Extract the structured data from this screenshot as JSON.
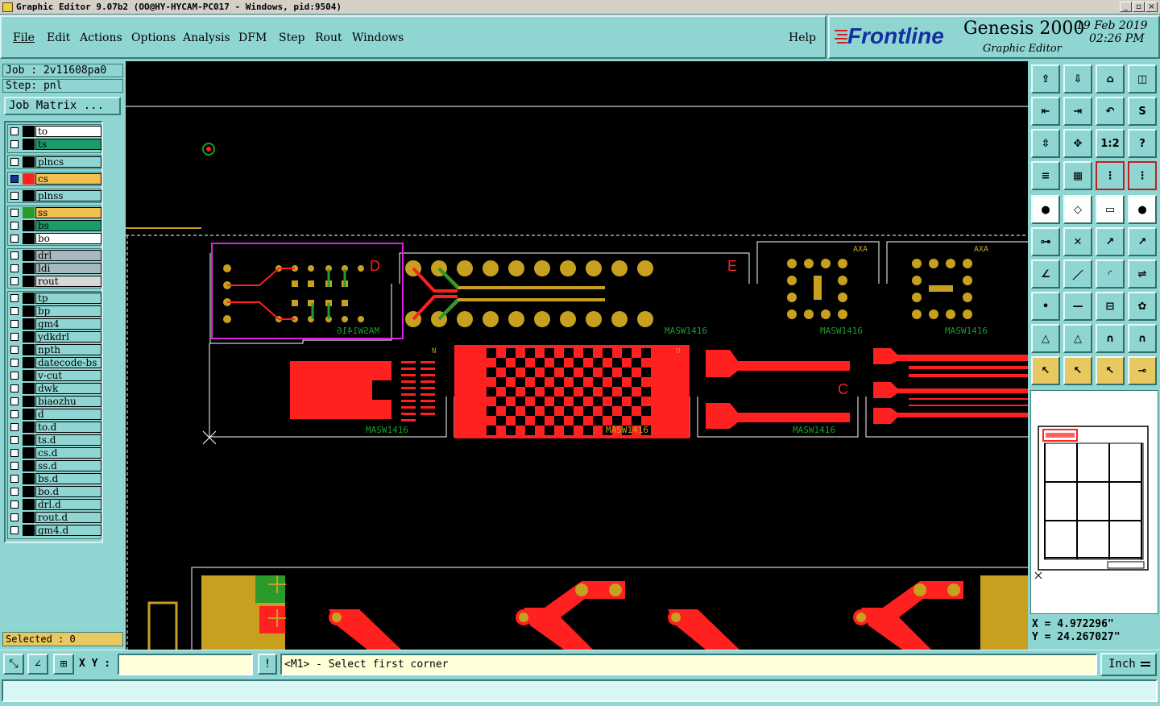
{
  "window": {
    "title": "Graphic Editor 9.07b2 (OO@HY-HYCAM-PC017 - Windows, pid:9504)"
  },
  "menu": [
    "File",
    "Edit",
    "Actions",
    "Options",
    "Analysis",
    "DFM",
    "Step",
    "Rout",
    "Windows"
  ],
  "help_label": "Help",
  "brand": {
    "logo": "Frontline",
    "product": "Genesis 2000",
    "subtitle": "Graphic Editor",
    "date": "19 Feb 2019",
    "time": "02:26 PM"
  },
  "job": {
    "job": "Job : 2v11608pa0",
    "step": "Step: pnl",
    "matrix_button": "Job Matrix ..."
  },
  "layers_group1": [
    {
      "name": "to",
      "color": "#ffffff",
      "swatch": "#000000"
    },
    {
      "name": "ts",
      "color": "#1a9c6a",
      "swatch": "#000000"
    }
  ],
  "layers_group2": [
    {
      "name": "plncs",
      "color": "#8fd6d2",
      "swatch": "#000000"
    }
  ],
  "layers_group3": [
    {
      "name": "cs",
      "color": "#f0c050",
      "swatch": "#ff2020",
      "active": true
    }
  ],
  "layers_group4": [
    {
      "name": "plnss",
      "color": "#8fd6d2",
      "swatch": "#000000"
    }
  ],
  "layers_group5": [
    {
      "name": "ss",
      "color": "#f0c050",
      "swatch": "#2a9a2a"
    },
    {
      "name": "bs",
      "color": "#1a9c6a",
      "swatch": "#000000"
    },
    {
      "name": "bo",
      "color": "#ffffff",
      "swatch": "#000000"
    }
  ],
  "layers_group6": [
    {
      "name": "drl",
      "color": "#a8b8c0",
      "swatch": "#000000"
    },
    {
      "name": "ldi",
      "color": "#a8b8c0",
      "swatch": "#000000"
    },
    {
      "name": "rout",
      "color": "#d8d8d8",
      "swatch": "#000000"
    }
  ],
  "layers_group7": [
    {
      "name": "tp"
    },
    {
      "name": "bp"
    },
    {
      "name": "gm4"
    },
    {
      "name": "ydkdrl"
    },
    {
      "name": "npth"
    },
    {
      "name": "datecode-bs"
    },
    {
      "name": "v-cut"
    },
    {
      "name": "dwk"
    },
    {
      "name": "biaozhu"
    },
    {
      "name": "d"
    },
    {
      "name": "to.d"
    },
    {
      "name": "ts.d"
    },
    {
      "name": "cs.d"
    },
    {
      "name": "ss.d"
    },
    {
      "name": "bs.d"
    },
    {
      "name": "bo.d"
    },
    {
      "name": "drl.d"
    },
    {
      "name": "rout.d"
    },
    {
      "name": "gm4.d"
    }
  ],
  "selected": "Selected : 0",
  "coords": {
    "x": "X = 4.972296\"",
    "y": "Y = 24.267027\""
  },
  "xy_label": "X Y :",
  "xy_value": "",
  "prompt": "<M1> - Select first corner",
  "units": "Inch",
  "canvas_labels": {
    "d": "D",
    "e": "E",
    "c": "C",
    "n": "N",
    "o": "O",
    "text_mark": "MASW1416",
    "text_axa": "AXA"
  },
  "toolbar_icons": [
    "zoom-up-icon",
    "zoom-down-icon",
    "home-icon",
    "split-view-icon",
    "pan-left-icon",
    "pan-right-icon",
    "undo-icon",
    "redraw-icon",
    "fit-vertical-icon",
    "fit-all-icon",
    "ratio-icon",
    "help-icon",
    "settings-icon",
    "grid-icon",
    "snap-icon",
    "snap2-icon"
  ],
  "toolbar2_labels": {
    "ratio": "1:2",
    "help": "?"
  }
}
